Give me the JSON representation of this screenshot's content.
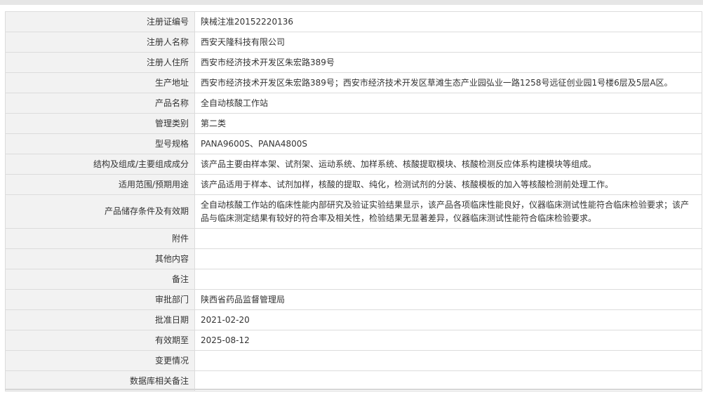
{
  "rows": [
    {
      "label": "注册证编号",
      "value": "陕械注准20152220136"
    },
    {
      "label": "注册人名称",
      "value": "西安天隆科技有限公司"
    },
    {
      "label": "注册人住所",
      "value": "西安市经济技术开发区朱宏路389号"
    },
    {
      "label": "生产地址",
      "value": "西安市经济技术开发区朱宏路389号；西安市经济技术开发区草滩生态产业园弘业一路1258号远征创业园1号楼6层及5层A区。"
    },
    {
      "label": "产品名称",
      "value": "全自动核酸工作站"
    },
    {
      "label": "管理类别",
      "value": "第二类"
    },
    {
      "label": "型号规格",
      "value": "PANA9600S、PANA4800S"
    },
    {
      "label": "结构及组成/主要组成成分",
      "value": "该产品主要由样本架、试剂架、运动系统、加样系统、核酸提取模块、核酸检测反应体系构建模块等组成。"
    },
    {
      "label": "适用范围/预期用途",
      "value": "该产品适用于样本、试剂加样，核酸的提取、纯化，检测试剂的分装、核酸模板的加入等核酸检测前处理工作。"
    },
    {
      "label": "产品储存条件及有效期",
      "value": "全自动核酸工作站的临床性能内部研究及验证实验结果显示，该产品各项临床性能良好，仪器临床测试性能符合临床检验要求；该产品与临床测定结果有较好的符合率及相关性，检验结果无显著差异，仪器临床测试性能符合临床检验要求。"
    },
    {
      "label": "附件",
      "value": ""
    },
    {
      "label": "其他内容",
      "value": ""
    },
    {
      "label": "备注",
      "value": ""
    },
    {
      "label": "审批部门",
      "value": "陕西省药品监督管理局"
    },
    {
      "label": "批准日期",
      "value": "2021-02-20"
    },
    {
      "label": "有效期至",
      "value": "2025-08-12"
    },
    {
      "label": "变更情况",
      "value": ""
    },
    {
      "label": "数据库相关备注",
      "value": ""
    }
  ]
}
